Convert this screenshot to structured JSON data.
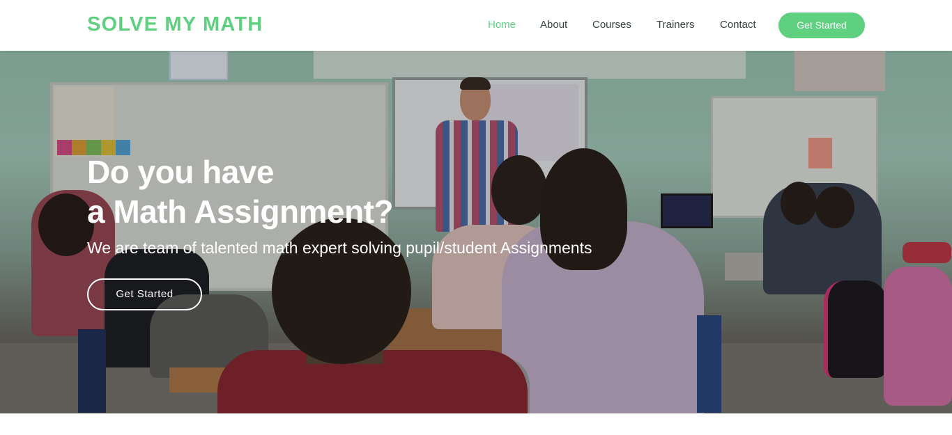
{
  "header": {
    "logo": "SOLVE MY MATH",
    "nav": {
      "home": "Home",
      "about": "About",
      "courses": "Courses",
      "trainers": "Trainers",
      "contact": "Contact"
    },
    "cta_label": "Get Started"
  },
  "hero": {
    "title_line1": "Do you have",
    "title_line2": "a Math Assignment?",
    "subtitle": "We are team of talented math expert solving pupil/student Assignments",
    "cta_label": "Get Started",
    "image_description_icon": "classroom-photo"
  },
  "colors": {
    "accent": "#5fcf80",
    "nav_text": "#37423b",
    "hero_text": "#ffffff"
  }
}
